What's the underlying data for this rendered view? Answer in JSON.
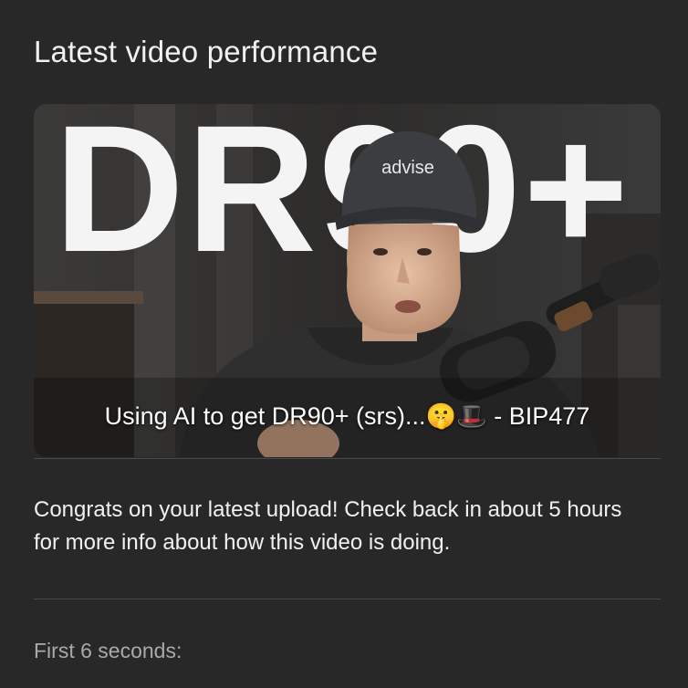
{
  "card": {
    "title": "Latest video performance"
  },
  "thumbnail": {
    "overlay_text": "DR90+",
    "cap_text": "advise",
    "video_title": "Using AI to get DR90+ (srs)...🤫🎩 - BIP477"
  },
  "message": "Congrats on your latest upload! Check back in about 5 hours for more info about how this video is doing.",
  "first_seconds_label": "First 6 seconds:",
  "colors": {
    "background": "#282828",
    "text_primary": "#f1f1f1",
    "text_secondary": "#a9a9a9",
    "divider": "#4a4a4a"
  }
}
